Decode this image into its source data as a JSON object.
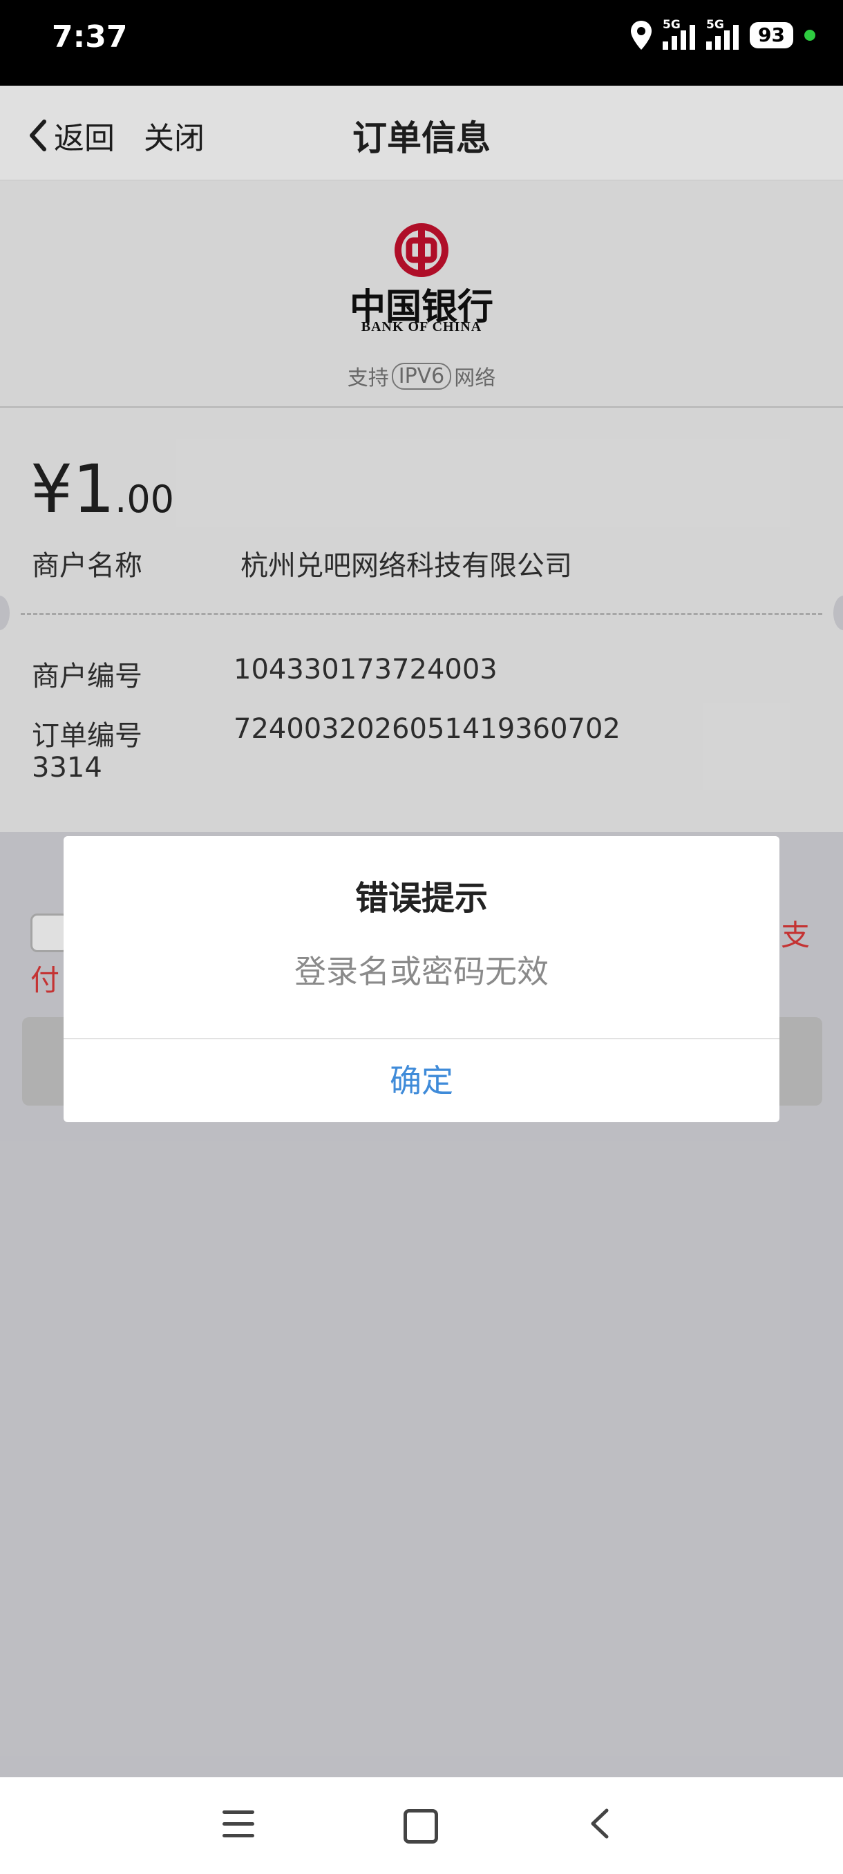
{
  "status_bar": {
    "time": "7:37",
    "signal1_tag": "5G",
    "signal2_tag": "5G",
    "battery": "93",
    "icons": [
      "location-icon",
      "signal-icon",
      "signal-icon",
      "battery-icon",
      "active-dot-icon"
    ]
  },
  "nav": {
    "back_label": "返回",
    "close_label": "关闭",
    "title": "订单信息"
  },
  "bank": {
    "name_cn": "中国银行",
    "name_en": "BANK OF CHINA",
    "ipv6_prefix": "支持",
    "ipv6_badge": "IPV6",
    "ipv6_suffix": "网络",
    "brand_color": "#c8102e"
  },
  "order": {
    "amount_symbol": "¥",
    "amount_int": "1",
    "amount_dec": ".00",
    "merchant_name_label": "商户名称",
    "merchant_name": "杭州兑吧网络科技有限公司",
    "merchant_id_label": "商户编号",
    "merchant_id": "104330173724003",
    "order_id_label_line1": "订单编号",
    "order_id_label_line2": "3314",
    "order_id": "7240032026051419360702"
  },
  "background_partial": {
    "red_text_right": "支",
    "red_text_left": "付"
  },
  "dialog": {
    "title": "错误提示",
    "message": "登录名或密码无效",
    "ok_label": "确定",
    "ok_color": "#3f8bd9"
  },
  "system_nav": {
    "icons": [
      "menu-icon",
      "home-icon",
      "back-icon"
    ]
  }
}
